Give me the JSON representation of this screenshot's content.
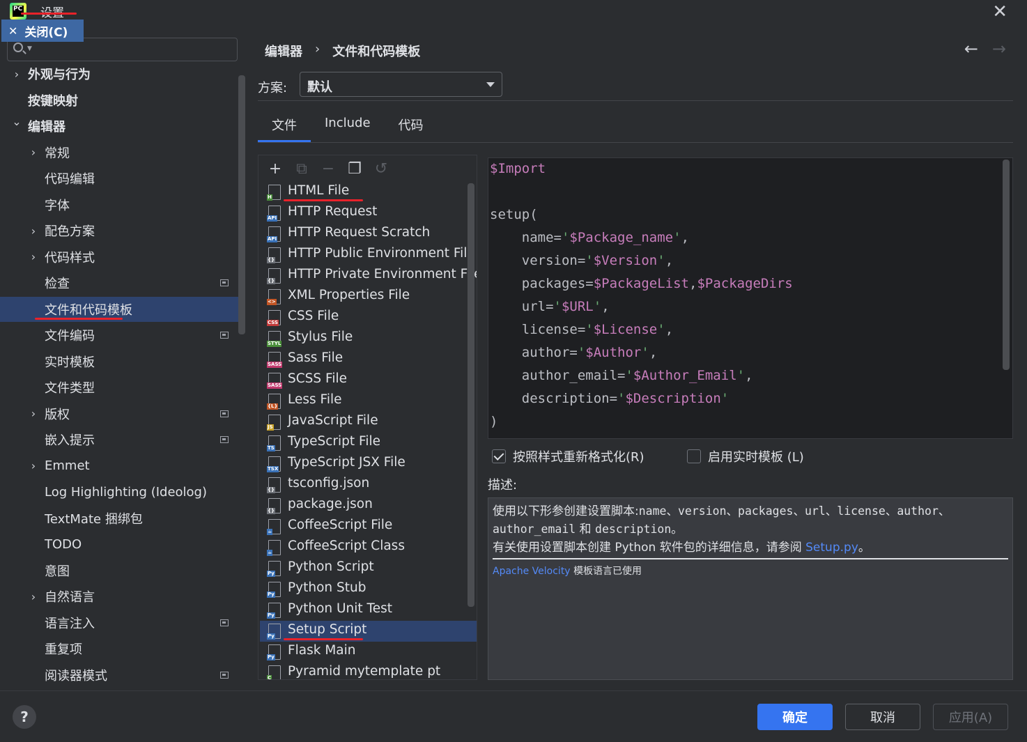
{
  "window": {
    "title": "设置",
    "close_icon": "close-icon"
  },
  "tooltip": {
    "close_label": "关闭(C)"
  },
  "search": {
    "placeholder": ""
  },
  "sidebar": {
    "items": [
      {
        "label": "外观与行为",
        "chevron": "right",
        "indent": 0
      },
      {
        "label": "按键映射",
        "chevron": "",
        "indent": 0
      },
      {
        "label": "编辑器",
        "chevron": "down",
        "indent": 0
      },
      {
        "label": "常规",
        "chevron": "right",
        "indent": 1
      },
      {
        "label": "代码编辑",
        "chevron": "",
        "indent": 1
      },
      {
        "label": "字体",
        "chevron": "",
        "indent": 1
      },
      {
        "label": "配色方案",
        "chevron": "right",
        "indent": 1
      },
      {
        "label": "代码样式",
        "chevron": "right",
        "indent": 1
      },
      {
        "label": "检查",
        "chevron": "",
        "indent": 1,
        "project": true
      },
      {
        "label": "文件和代码模板",
        "chevron": "",
        "indent": 1,
        "selected": true
      },
      {
        "label": "文件编码",
        "chevron": "",
        "indent": 1,
        "project": true
      },
      {
        "label": "实时模板",
        "chevron": "",
        "indent": 1
      },
      {
        "label": "文件类型",
        "chevron": "",
        "indent": 1
      },
      {
        "label": "版权",
        "chevron": "right",
        "indent": 1,
        "project": true
      },
      {
        "label": "嵌入提示",
        "chevron": "",
        "indent": 1,
        "project": true
      },
      {
        "label": "Emmet",
        "chevron": "right",
        "indent": 1
      },
      {
        "label": "Log Highlighting (Ideolog)",
        "chevron": "",
        "indent": 1
      },
      {
        "label": "TextMate 捆绑包",
        "chevron": "",
        "indent": 1
      },
      {
        "label": "TODO",
        "chevron": "",
        "indent": 1
      },
      {
        "label": "意图",
        "chevron": "",
        "indent": 1
      },
      {
        "label": "自然语言",
        "chevron": "right",
        "indent": 1
      },
      {
        "label": "语言注入",
        "chevron": "",
        "indent": 1,
        "project": true
      },
      {
        "label": "重复项",
        "chevron": "",
        "indent": 1
      },
      {
        "label": "阅读器模式",
        "chevron": "",
        "indent": 1,
        "project": true
      }
    ]
  },
  "breadcrumb": {
    "parent": "编辑器",
    "separator": "›",
    "current": "文件和代码模板"
  },
  "scheme": {
    "label": "方案:",
    "value": "默认"
  },
  "tabs": [
    {
      "label": "文件",
      "active": true
    },
    {
      "label": "Include",
      "active": false
    },
    {
      "label": "代码",
      "active": false
    }
  ],
  "toolbar": {
    "add": "+",
    "copy_add": "⧉",
    "remove": "−",
    "copy": "❐",
    "reset": "↺"
  },
  "templates": [
    {
      "label": "HTML File",
      "tag": "H",
      "tag_color": "#4a8f3a"
    },
    {
      "label": "HTTP Request",
      "tag": "API",
      "tag_color": "#3a72b8"
    },
    {
      "label": "HTTP Request Scratch",
      "tag": "API",
      "tag_color": "#3a72b8"
    },
    {
      "label": "HTTP Public Environment File",
      "tag": "{}",
      "tag_color": "#6f737a"
    },
    {
      "label": "HTTP Private Environment File",
      "tag": "{}",
      "tag_color": "#6f737a"
    },
    {
      "label": "XML Properties File",
      "tag": "<>",
      "tag_color": "#c25525"
    },
    {
      "label": "CSS File",
      "tag": "CSS",
      "tag_color": "#c23a3a"
    },
    {
      "label": "Stylus File",
      "tag": "STYL",
      "tag_color": "#4a8f3a"
    },
    {
      "label": "Sass File",
      "tag": "SASS",
      "tag_color": "#c23a6e"
    },
    {
      "label": "SCSS File",
      "tag": "SASS",
      "tag_color": "#c23a6e"
    },
    {
      "label": "Less File",
      "tag": "{L}",
      "tag_color": "#c25525"
    },
    {
      "label": "JavaScript File",
      "tag": "JS",
      "tag_color": "#c9a227"
    },
    {
      "label": "TypeScript File",
      "tag": "TS",
      "tag_color": "#3a72b8"
    },
    {
      "label": "TypeScript JSX File",
      "tag": "TSX",
      "tag_color": "#3a72b8"
    },
    {
      "label": "tsconfig.json",
      "tag": "{}",
      "tag_color": "#6f737a"
    },
    {
      "label": "package.json",
      "tag": "{}",
      "tag_color": "#6f737a"
    },
    {
      "label": "CoffeeScript File",
      "tag": "☕",
      "tag_color": "#3a72b8"
    },
    {
      "label": "CoffeeScript Class",
      "tag": "☕",
      "tag_color": "#3a72b8"
    },
    {
      "label": "Python Script",
      "tag": "Py",
      "tag_color": "#3a72b8"
    },
    {
      "label": "Python Stub",
      "tag": "Py",
      "tag_color": "#3a72b8"
    },
    {
      "label": "Python Unit Test",
      "tag": "Py",
      "tag_color": "#3a72b8"
    },
    {
      "label": "Setup Script",
      "tag": "Py",
      "tag_color": "#3a72b8",
      "selected": true
    },
    {
      "label": "Flask Main",
      "tag": "Py",
      "tag_color": "#3a72b8"
    },
    {
      "label": "Pyramid mytemplate pt",
      "tag": "C",
      "tag_color": "#4a8f3a"
    }
  ],
  "editor": {
    "lines": [
      [
        [
          "var",
          "$Import"
        ]
      ],
      [],
      [
        [
          "plain",
          "setup("
        ]
      ],
      [
        [
          "plain",
          "    name="
        ],
        [
          "q",
          "'"
        ],
        [
          "var",
          "$Package_name"
        ],
        [
          "q",
          "'"
        ],
        [
          "plain",
          ","
        ]
      ],
      [
        [
          "plain",
          "    version="
        ],
        [
          "q",
          "'"
        ],
        [
          "var",
          "$Version"
        ],
        [
          "q",
          "'"
        ],
        [
          "plain",
          ","
        ]
      ],
      [
        [
          "plain",
          "    packages="
        ],
        [
          "var",
          "$PackageList"
        ],
        [
          "plain",
          ","
        ],
        [
          "var",
          "$PackageDirs"
        ]
      ],
      [
        [
          "plain",
          "    url="
        ],
        [
          "q",
          "'"
        ],
        [
          "var",
          "$URL"
        ],
        [
          "q",
          "'"
        ],
        [
          "plain",
          ","
        ]
      ],
      [
        [
          "plain",
          "    license="
        ],
        [
          "q",
          "'"
        ],
        [
          "var",
          "$License"
        ],
        [
          "q",
          "'"
        ],
        [
          "plain",
          ","
        ]
      ],
      [
        [
          "plain",
          "    author="
        ],
        [
          "q",
          "'"
        ],
        [
          "var",
          "$Author"
        ],
        [
          "q",
          "'"
        ],
        [
          "plain",
          ","
        ]
      ],
      [
        [
          "plain",
          "    author_email="
        ],
        [
          "q",
          "'"
        ],
        [
          "var",
          "$Author_Email"
        ],
        [
          "q",
          "'"
        ],
        [
          "plain",
          ","
        ]
      ],
      [
        [
          "plain",
          "    description="
        ],
        [
          "q",
          "'"
        ],
        [
          "var",
          "$Description"
        ],
        [
          "q",
          "'"
        ]
      ],
      [
        [
          "plain",
          ")"
        ]
      ]
    ]
  },
  "options": {
    "reformat_label": "按照样式重新格式化(R)",
    "reformat_checked": true,
    "live_template_label": "启用实时模板 (L)",
    "live_template_checked": false
  },
  "description": {
    "label": "描述:",
    "line1_prefix": "使用以下形参创建设置脚本:",
    "line1_params": "name、version、packages、url、license、author、",
    "line2_params": "author_email",
    "line2_and": "和",
    "line2_last": "description。",
    "line3_prefix": "有关使用设置脚本创建 Python 软件包的详细信息，请参阅",
    "line3_link": "Setup.py",
    "line3_suffix": "。",
    "velocity_link": "Apache Velocity",
    "velocity_text": "模板语言已使用"
  },
  "buttons": {
    "help": "?",
    "ok": "确定",
    "cancel": "取消",
    "apply": "应用(A)"
  },
  "colors": {
    "accent": "#3574f0",
    "selected_bg": "#2e436e",
    "annotation_red": "#e8222a"
  }
}
